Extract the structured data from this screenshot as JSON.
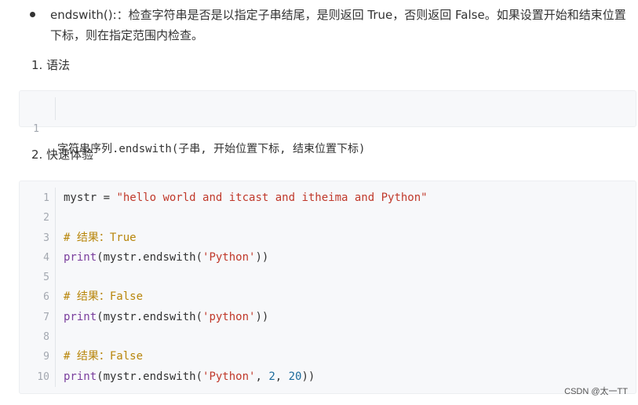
{
  "bullet": {
    "text": "endswith():：检查字符串是否是以指定子串结尾，是则返回 True，否则返回 False。如果设置开始和结束位置下标，则在指定范围内检查。"
  },
  "section1": {
    "title": "1. 语法"
  },
  "syntax_code": {
    "lines": [
      {
        "num": "1",
        "code": "字符串序列.endswith(子串, 开始位置下标, 结束位置下标)"
      }
    ]
  },
  "section2": {
    "title": "2. 快速体验"
  },
  "example_code": {
    "lines": [
      {
        "num": "1",
        "code": "mystr = \"hello world and itcast and itheima and Python\""
      },
      {
        "num": "2",
        "code": ""
      },
      {
        "num": "3",
        "code": "# 结果：True"
      },
      {
        "num": "4",
        "code": "print(mystr.endswith('Python'))"
      },
      {
        "num": "5",
        "code": ""
      },
      {
        "num": "6",
        "code": "# 结果：False"
      },
      {
        "num": "7",
        "code": "print(mystr.endswith('python'))"
      },
      {
        "num": "8",
        "code": ""
      },
      {
        "num": "9",
        "code": "# 结果：False"
      },
      {
        "num": "10",
        "code": "print(mystr.endswith('Python', 2, 20))"
      }
    ]
  },
  "watermark": {
    "text": "CSDN @太一TT"
  }
}
